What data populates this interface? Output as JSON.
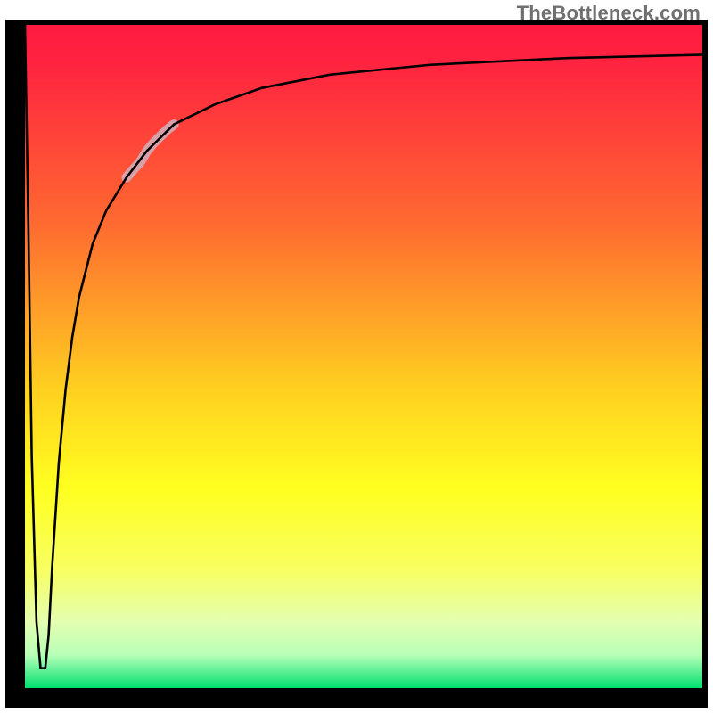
{
  "attribution": "TheBottleneck.com",
  "chart_data": {
    "type": "line",
    "title": "",
    "xlabel": "",
    "ylabel": "",
    "xlim": [
      0,
      100
    ],
    "ylim": [
      0,
      100
    ],
    "grid": false,
    "legend": false,
    "background_gradient": {
      "direction": "vertical",
      "stops": [
        {
          "pos": 0.0,
          "color": "#ff1a40"
        },
        {
          "pos": 0.3,
          "color": "#ff6a30"
        },
        {
          "pos": 0.55,
          "color": "#ffd020"
        },
        {
          "pos": 0.7,
          "color": "#ffff20"
        },
        {
          "pos": 0.9,
          "color": "#e4ffb0"
        },
        {
          "pos": 1.0,
          "color": "#00e070"
        }
      ]
    },
    "series": [
      {
        "name": "bottleneck-curve",
        "color": "#000000",
        "x": [
          0.0,
          0.5,
          1.0,
          1.7,
          2.3,
          3.0,
          3.5,
          4.0,
          5.0,
          6.0,
          7.0,
          8.0,
          10.0,
          12.0,
          15.0,
          18.0,
          22.0,
          28.0,
          35.0,
          45.0,
          60.0,
          80.0,
          100.0
        ],
        "y": [
          100.0,
          70.0,
          35.0,
          10.0,
          3.0,
          3.0,
          8.0,
          18.0,
          34.0,
          45.0,
          53.0,
          59.0,
          67.0,
          72.0,
          77.0,
          81.0,
          85.0,
          88.0,
          90.5,
          92.5,
          94.0,
          95.0,
          95.5
        ]
      },
      {
        "name": "highlight-segment",
        "color": "#d8a0a8",
        "stroke_width": 10,
        "x": [
          15.0,
          16.0,
          17.0,
          18.0,
          19.0,
          20.0,
          21.0,
          22.0
        ],
        "y": [
          77.0,
          78.2,
          79.3,
          81.0,
          82.2,
          83.2,
          84.2,
          85.0
        ]
      }
    ]
  }
}
